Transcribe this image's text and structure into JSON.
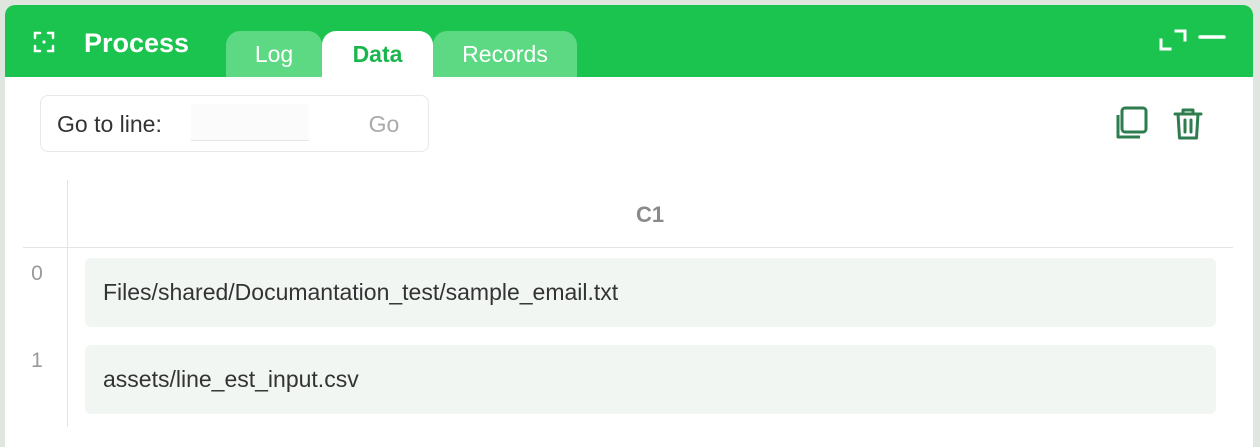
{
  "window": {
    "title": "Process",
    "icons": {
      "process": "process-icon",
      "maximize": "maximize-icon",
      "minimize": "minimize-icon"
    },
    "colors": {
      "header": "#1ac44f",
      "inactive_tab": "#5dd883",
      "active_tab_text": "#1ab54c",
      "icon": "#2e7d4f"
    }
  },
  "tabs": [
    {
      "label": "Log",
      "active": false
    },
    {
      "label": "Data",
      "active": true
    },
    {
      "label": "Records",
      "active": false
    }
  ],
  "toolbar": {
    "goto_label": "Go to line:",
    "goto_value": "",
    "goto_button": "Go",
    "copy_icon": "copy-icon",
    "delete_icon": "trash-icon"
  },
  "table": {
    "columns": [
      "C1"
    ],
    "rows": [
      {
        "index": "0",
        "cells": [
          "Files/shared/Documantation_test/sample_email.txt"
        ]
      },
      {
        "index": "1",
        "cells": [
          "assets/line_est_input.csv"
        ]
      }
    ]
  }
}
